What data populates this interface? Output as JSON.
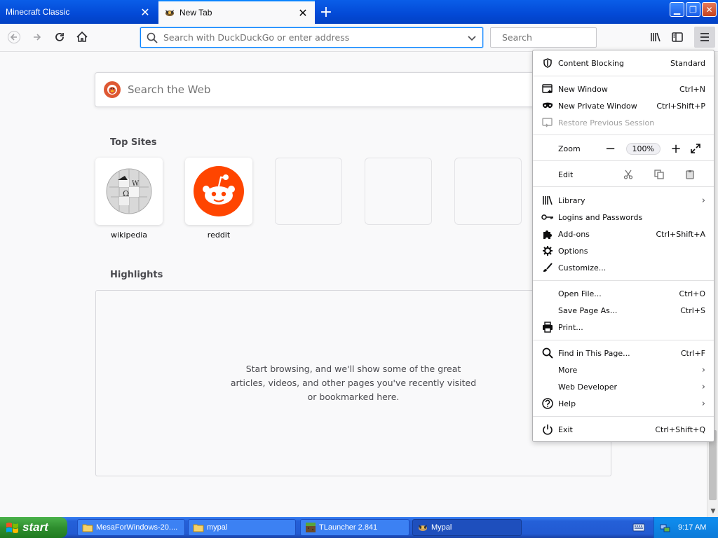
{
  "tabs": [
    {
      "title": "Minecraft Classic",
      "active": false
    },
    {
      "title": "New Tab",
      "active": true
    }
  ],
  "navbar": {
    "url_placeholder": "Search with DuckDuckGo or enter address",
    "search_placeholder": "Search"
  },
  "newtab": {
    "search_placeholder": "Search the Web",
    "top_sites_title": "Top Sites",
    "sites": [
      {
        "label": "wikipedia"
      },
      {
        "label": "reddit"
      }
    ],
    "highlights_title": "Highlights",
    "highlights_empty": "Start browsing, and we'll show some of the great articles, videos, and other pages you've recently visited or bookmarked here."
  },
  "menu": {
    "content_blocking": {
      "label": "Content Blocking",
      "value": "Standard"
    },
    "new_window": {
      "label": "New Window",
      "shortcut": "Ctrl+N"
    },
    "new_private_window": {
      "label": "New Private Window",
      "shortcut": "Ctrl+Shift+P"
    },
    "restore_session": {
      "label": "Restore Previous Session"
    },
    "zoom": {
      "label": "Zoom",
      "minus": "−",
      "value": "100%",
      "plus": "+"
    },
    "edit": {
      "label": "Edit"
    },
    "library": {
      "label": "Library"
    },
    "logins": {
      "label": "Logins and Passwords"
    },
    "addons": {
      "label": "Add-ons",
      "shortcut": "Ctrl+Shift+A"
    },
    "options": {
      "label": "Options"
    },
    "customize": {
      "label": "Customize..."
    },
    "open_file": {
      "label": "Open File...",
      "shortcut": "Ctrl+O"
    },
    "save_page": {
      "label": "Save Page As...",
      "shortcut": "Ctrl+S"
    },
    "print": {
      "label": "Print..."
    },
    "find": {
      "label": "Find in This Page...",
      "shortcut": "Ctrl+F"
    },
    "more": {
      "label": "More"
    },
    "web_developer": {
      "label": "Web Developer"
    },
    "help": {
      "label": "Help"
    },
    "exit": {
      "label": "Exit",
      "shortcut": "Ctrl+Shift+Q"
    }
  },
  "taskbar": {
    "start_label": "start",
    "tasks": [
      {
        "label": "MesaForWindows-20....",
        "icon": "folder-icon"
      },
      {
        "label": "mypal",
        "icon": "folder-icon"
      },
      {
        "label": "TLauncher 2.841",
        "icon": "minecraft-block-icon"
      },
      {
        "label": "Mypal",
        "icon": "mypal-icon",
        "active": true
      }
    ],
    "clock": "9:17 AM"
  },
  "colors": {
    "accent": "#0a84ff",
    "titlebar": "#0349d6",
    "reddit": "#ff4500",
    "duckduckgo": "#de5833"
  }
}
